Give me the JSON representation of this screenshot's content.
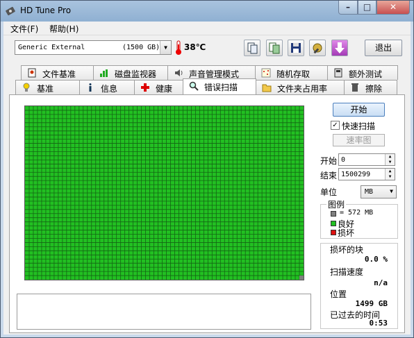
{
  "window": {
    "title": "HD Tune Pro",
    "minimize": "–",
    "maximize": "□",
    "close": "✕"
  },
  "menu": {
    "file": "文件(F)",
    "help": "帮助(H)"
  },
  "toolbar": {
    "drive_name": "Generic External",
    "drive_capacity": "(1500 GB)",
    "temperature": "38℃",
    "exit_label": "退出"
  },
  "tabs_top": [
    {
      "label": "文件基准"
    },
    {
      "label": "磁盘监视器"
    },
    {
      "label": "声音管理模式"
    },
    {
      "label": "随机存取"
    },
    {
      "label": "额外测试"
    }
  ],
  "tabs_bottom": [
    {
      "label": "基准"
    },
    {
      "label": "信息"
    },
    {
      "label": "健康"
    },
    {
      "label": "错误扫描"
    },
    {
      "label": "文件夹占用率"
    },
    {
      "label": "擦除"
    }
  ],
  "scan": {
    "start_label": "开始",
    "quick_scan_label": "快速扫描",
    "quick_scan_checked": true,
    "speed_map_label": "速率图",
    "start_field_label": "开始",
    "start_value": "0",
    "end_field_label": "结束",
    "end_value": "1500299",
    "unit_label": "单位",
    "unit_value": "MB",
    "legend_title": "图例",
    "legend_block": "= 572 MB",
    "legend_good": "良好",
    "legend_bad": "损坏",
    "bad_blocks_label": "损坏的块",
    "bad_blocks_value": "0.0 %",
    "scan_speed_label": "扫描速度",
    "scan_speed_value": "n/a",
    "position_label": "位置",
    "position_value": "1499 GB",
    "elapsed_label": "已过去的时间",
    "elapsed_value": "0:53",
    "grid_cols": 67,
    "grid_rows": 42,
    "good_color": "#22c022",
    "bad_color": "#dd1111"
  }
}
